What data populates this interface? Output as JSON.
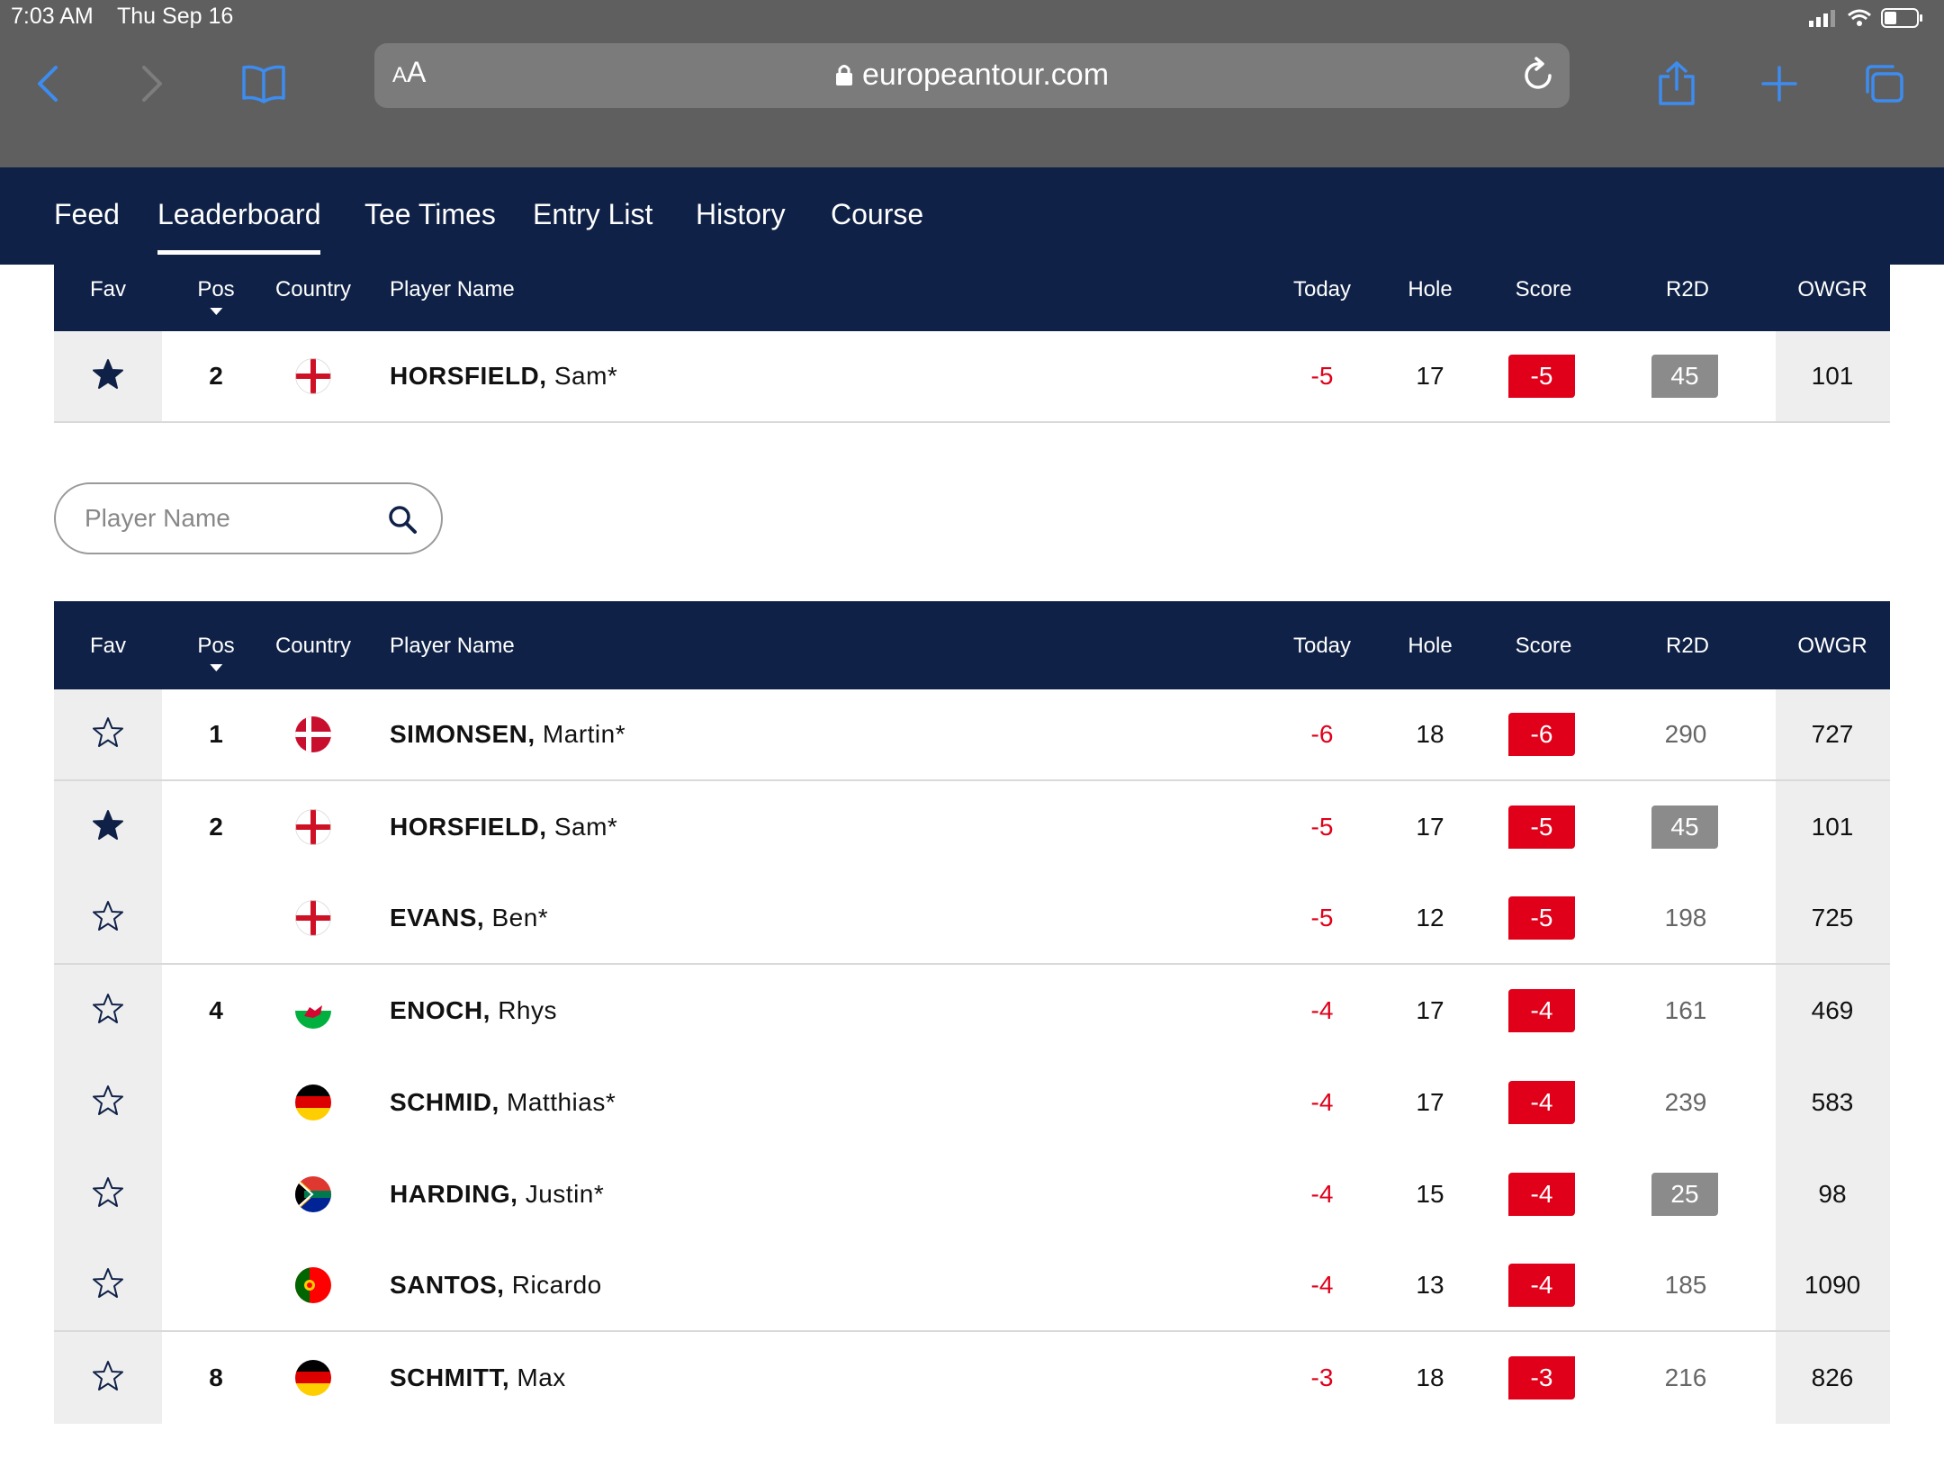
{
  "status_bar": {
    "time": "7:03 AM",
    "date": "Thu Sep 16"
  },
  "browser": {
    "aa_label_small": "A",
    "aa_label_big": "A",
    "url": "europeantour.com"
  },
  "nav": {
    "tabs": [
      {
        "label": "Feed"
      },
      {
        "label": "Leaderboard"
      },
      {
        "label": "Tee Times"
      },
      {
        "label": "Entry List"
      },
      {
        "label": "History"
      },
      {
        "label": "Course"
      }
    ],
    "active_tab": "Leaderboard"
  },
  "columns": {
    "fav": "Fav",
    "pos": "Pos",
    "country": "Country",
    "player": "Player Name",
    "today": "Today",
    "hole": "Hole",
    "score": "Score",
    "r2d": "R2D",
    "owgr": "OWGR"
  },
  "favorites": {
    "rows": [
      {
        "fav": true,
        "pos": "2",
        "flag": "england",
        "last": "HORSFIELD,",
        "first": "Sam*",
        "today": "-5",
        "hole": "17",
        "score": "-5",
        "r2d": "45",
        "r2d_highlight": true,
        "owgr": "101"
      }
    ]
  },
  "search": {
    "placeholder": "Player Name"
  },
  "leaderboard": {
    "rows": [
      {
        "fav": false,
        "pos": "1",
        "flag": "denmark",
        "last": "SIMONSEN,",
        "first": "Martin*",
        "today": "-6",
        "hole": "18",
        "score": "-6",
        "r2d": "290",
        "r2d_highlight": false,
        "owgr": "727"
      },
      {
        "fav": true,
        "pos": "2",
        "flag": "england",
        "last": "HORSFIELD,",
        "first": "Sam*",
        "today": "-5",
        "hole": "17",
        "score": "-5",
        "r2d": "45",
        "r2d_highlight": true,
        "owgr": "101"
      },
      {
        "fav": false,
        "pos": "",
        "flag": "england",
        "last": "EVANS,",
        "first": "Ben*",
        "today": "-5",
        "hole": "12",
        "score": "-5",
        "r2d": "198",
        "r2d_highlight": false,
        "owgr": "725"
      },
      {
        "fav": false,
        "pos": "4",
        "flag": "wales",
        "last": "ENOCH,",
        "first": "Rhys",
        "today": "-4",
        "hole": "17",
        "score": "-4",
        "r2d": "161",
        "r2d_highlight": false,
        "owgr": "469"
      },
      {
        "fav": false,
        "pos": "",
        "flag": "germany",
        "last": "SCHMID,",
        "first": "Matthias*",
        "today": "-4",
        "hole": "17",
        "score": "-4",
        "r2d": "239",
        "r2d_highlight": false,
        "owgr": "583"
      },
      {
        "fav": false,
        "pos": "",
        "flag": "south-africa",
        "last": "HARDING,",
        "first": "Justin*",
        "today": "-4",
        "hole": "15",
        "score": "-4",
        "r2d": "25",
        "r2d_highlight": true,
        "owgr": "98"
      },
      {
        "fav": false,
        "pos": "",
        "flag": "portugal",
        "last": "SANTOS,",
        "first": "Ricardo",
        "today": "-4",
        "hole": "13",
        "score": "-4",
        "r2d": "185",
        "r2d_highlight": false,
        "owgr": "1090"
      },
      {
        "fav": false,
        "pos": "8",
        "flag": "germany",
        "last": "SCHMITT,",
        "first": "Max",
        "today": "-3",
        "hole": "18",
        "score": "-3",
        "r2d": "216",
        "r2d_highlight": false,
        "owgr": "826"
      }
    ]
  },
  "colors": {
    "navy": "#0f2147",
    "red": "#e0001a",
    "grey_badge": "#8b8b8b",
    "ios_blue": "#3d8cf0"
  }
}
